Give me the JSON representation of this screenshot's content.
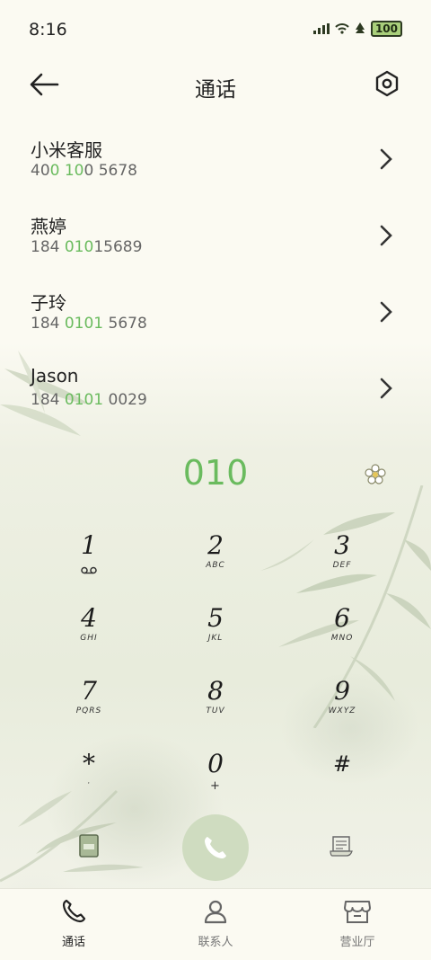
{
  "status": {
    "time": "8:16",
    "battery": "100",
    "icons": [
      "signal-icon",
      "wifi-icon",
      "tree-icon",
      "battery-icon"
    ]
  },
  "header": {
    "title": "通话",
    "back_icon": "arrow-left-icon",
    "settings_icon": "hexagon-settings-icon"
  },
  "contacts": [
    {
      "name": "小米客服",
      "pre": "40",
      "hl": "0 10",
      "post": "0 5678"
    },
    {
      "name": "燕婷",
      "pre": "184 ",
      "hl": "010",
      "post": "15689"
    },
    {
      "name": "子玲",
      "pre": "184 ",
      "hl": "0101",
      "post": " 5678"
    },
    {
      "name": "Jason",
      "pre": "184 ",
      "hl": "0101",
      "post": " 0029"
    }
  ],
  "dialer": {
    "input": "010",
    "accent": "#6abb5e"
  },
  "keys": [
    {
      "digit": "1",
      "letters": ""
    },
    {
      "digit": "2",
      "letters": "ABC"
    },
    {
      "digit": "3",
      "letters": "DEF"
    },
    {
      "digit": "4",
      "letters": "GHI"
    },
    {
      "digit": "5",
      "letters": "JKL"
    },
    {
      "digit": "6",
      "letters": "MNO"
    },
    {
      "digit": "7",
      "letters": "PQRS"
    },
    {
      "digit": "8",
      "letters": "TUV"
    },
    {
      "digit": "9",
      "letters": "WXYZ"
    },
    {
      "digit": "*",
      "letters": "·"
    },
    {
      "digit": "0",
      "letters": "+"
    },
    {
      "digit": "#",
      "letters": ""
    }
  ],
  "tabs": [
    {
      "label": "通话",
      "icon": "phone-icon",
      "active": true
    },
    {
      "label": "联系人",
      "icon": "person-icon",
      "active": false
    },
    {
      "label": "营业厅",
      "icon": "store-icon",
      "active": false
    }
  ]
}
